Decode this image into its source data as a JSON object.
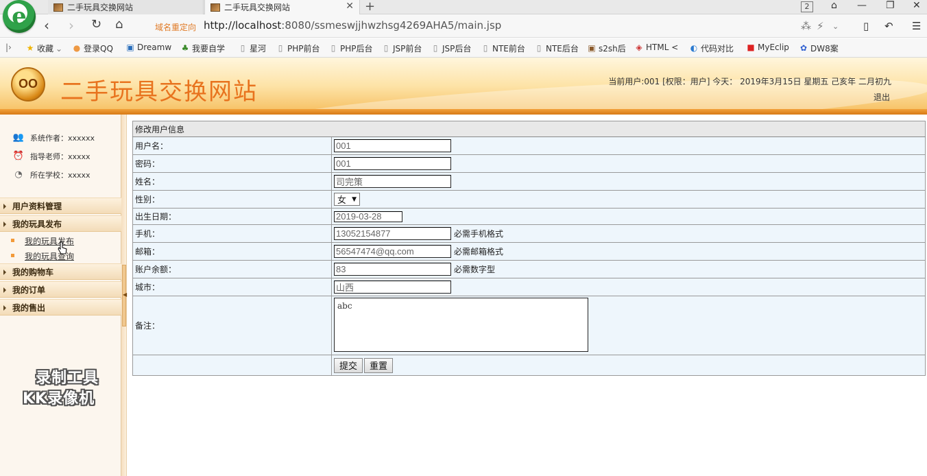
{
  "browser": {
    "tabs": [
      {
        "label": "二手玩具交换网站",
        "active": false
      },
      {
        "label": "二手玩具交换网站",
        "active": true
      }
    ],
    "tab_count": "2",
    "redirect_label": "域名重定向",
    "address_host": "http://localhost",
    "address_rest": ":8080/ssmeswjjhwzhsg4269AHA5/main.jsp",
    "bookmarks": [
      {
        "icon": "star-icon",
        "label": "收藏"
      },
      {
        "icon": "globe-icon",
        "label": "登录QQ"
      },
      {
        "icon": "page-icon",
        "label": "Dreamw"
      },
      {
        "icon": "leaf-icon",
        "label": "我要自学"
      },
      {
        "icon": "page-icon",
        "label": "星河"
      },
      {
        "icon": "page-icon",
        "label": "PHP前台"
      },
      {
        "icon": "page-icon",
        "label": "PHP后台"
      },
      {
        "icon": "page-icon",
        "label": "JSP前台"
      },
      {
        "icon": "page-icon",
        "label": "JSP后台"
      },
      {
        "icon": "page-icon",
        "label": "NTE前台"
      },
      {
        "icon": "page-icon",
        "label": "NTE后台"
      },
      {
        "icon": "page-icon",
        "label": "s2sh后"
      },
      {
        "icon": "html-icon",
        "label": "HTML <"
      },
      {
        "icon": "compare-icon",
        "label": "代码对比"
      },
      {
        "icon": "eclipse-icon",
        "label": "MyEclip"
      },
      {
        "icon": "paw-icon",
        "label": "DW8案"
      }
    ]
  },
  "header": {
    "logo_text": "OO",
    "title": "二手玩具交换网站",
    "user_info": "当前用户:001 [权限：用户] 今天： 2019年3月15日 星期五 己亥年 二月初九",
    "logout": "退出"
  },
  "sidebar": {
    "info": [
      {
        "icon": "users-icon",
        "label": "系统作者：xxxxxx"
      },
      {
        "icon": "alarm-clock-icon",
        "label": "指导老师：xxxxx"
      },
      {
        "icon": "clock-icon",
        "label": "所在学校：xxxxx"
      }
    ],
    "menu": [
      {
        "label": "用户资料管理"
      },
      {
        "label": "我的玩具发布",
        "items": [
          "我的玩具发布",
          "我的玩具查询"
        ]
      },
      {
        "label": "我的购物车"
      },
      {
        "label": "我的订单"
      },
      {
        "label": "我的售出"
      }
    ],
    "watermark_line1": "录制工具",
    "watermark_line2": "KK录像机"
  },
  "form": {
    "title": "修改用户信息",
    "username_label": "用户名：",
    "username": "001",
    "password_label": "密码：",
    "password": "001",
    "name_label": "姓名：",
    "name": "司完策",
    "gender_label": "性别：",
    "gender": "女",
    "birth_label": "出生日期：",
    "birth": "2019-03-28",
    "phone_label": "手机：",
    "phone": "13052154877",
    "phone_hint": "必需手机格式",
    "email_label": "邮箱：",
    "email": "56547474@qq.com",
    "email_hint": "必需邮箱格式",
    "balance_label": "账户余额：",
    "balance": "83",
    "balance_hint": "必需数字型",
    "city_label": "城市：",
    "city": "山西",
    "notes_label": "备注：",
    "notes": "abc",
    "submit": "提交",
    "reset": "重置"
  }
}
